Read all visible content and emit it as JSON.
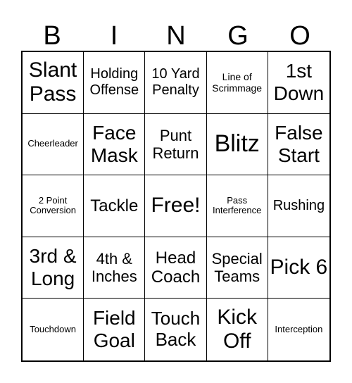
{
  "header": [
    "B",
    "I",
    "N",
    "G",
    "O"
  ],
  "cells": [
    "Slant Pass",
    "Holding Offense",
    "10 Yard Penalty",
    "Line of Scrimmage",
    "1st Down",
    "Cheerleader",
    "Face Mask",
    "Punt Return",
    "Blitz",
    "False Start",
    "2 Point Conversion",
    "Tackle",
    "Free!",
    "Pass Interference",
    "Rushing",
    "3rd & Long",
    "4th & Inches",
    "Head Coach",
    "Special Teams",
    "Pick 6",
    "Touchdown",
    "Field Goal",
    "Touch Back",
    "Kick Off",
    "Interception"
  ]
}
